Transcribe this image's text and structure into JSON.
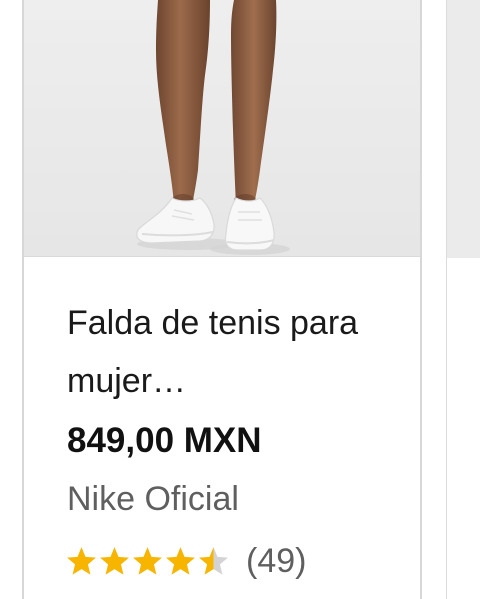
{
  "product": {
    "title": "Falda de tenis para mujer…",
    "price": "849,00 MXN",
    "seller": "Nike Oficial",
    "rating": 4.5,
    "rating_max": 5,
    "review_count": "(49)",
    "image_icon": "product-photo-legs-white-sneakers"
  },
  "colors": {
    "star_fill": "#f7b500",
    "star_empty": "#d3d3d3",
    "title": "#1a1a1a",
    "seller": "#5f5f5f",
    "image_bg": "#ececec"
  }
}
